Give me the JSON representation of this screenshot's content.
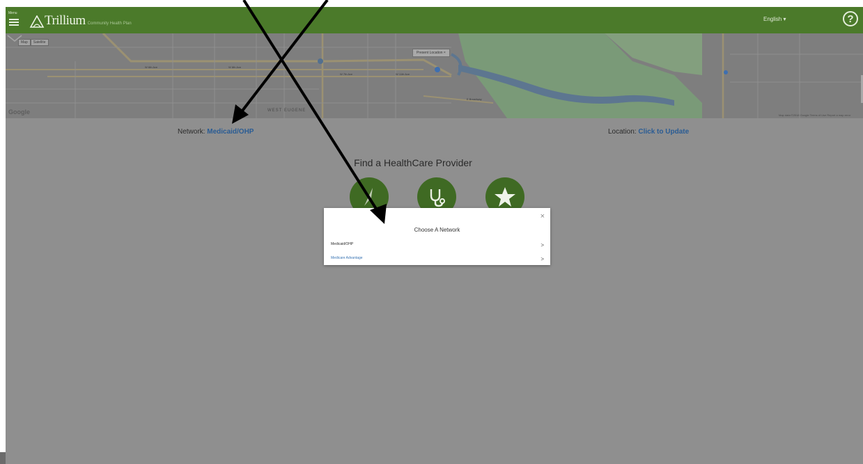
{
  "header": {
    "menu_label": "Menu",
    "logo_text": "Trillium",
    "logo_sub": "Community Health Plan",
    "language": "English ▾",
    "help_symbol": "?",
    "brand_color": "#4b7a2a"
  },
  "map": {
    "tab_map": "Map",
    "tab_satellite": "Satellite",
    "present_location": "Present Location",
    "present_location_close": "×",
    "google": "Google",
    "terms": "Map data ©2018 Google  Terms of Use  Report a map error",
    "street_labels": [
      "W 6th Ave",
      "W 8th Ave",
      "W 7th Ave",
      "W 11th Ave",
      "WEST EUGENE",
      "E Broadway"
    ]
  },
  "network_row": {
    "network_label": "Network:",
    "network_value": "Medicaid/OHP",
    "location_label": "Location:",
    "location_value": "Click to Update",
    "link_color": "#2a5c94"
  },
  "finder": {
    "title": "Find a HealthCare Provider",
    "icons": [
      "lightning-icon",
      "stethoscope-icon",
      "star-icon"
    ]
  },
  "modal": {
    "title": "Choose A Network",
    "close": "×",
    "options": [
      {
        "label": "Medicaid/OHP",
        "arrow": ">"
      },
      {
        "label": "Medicare Advantage",
        "arrow": ">"
      }
    ]
  }
}
